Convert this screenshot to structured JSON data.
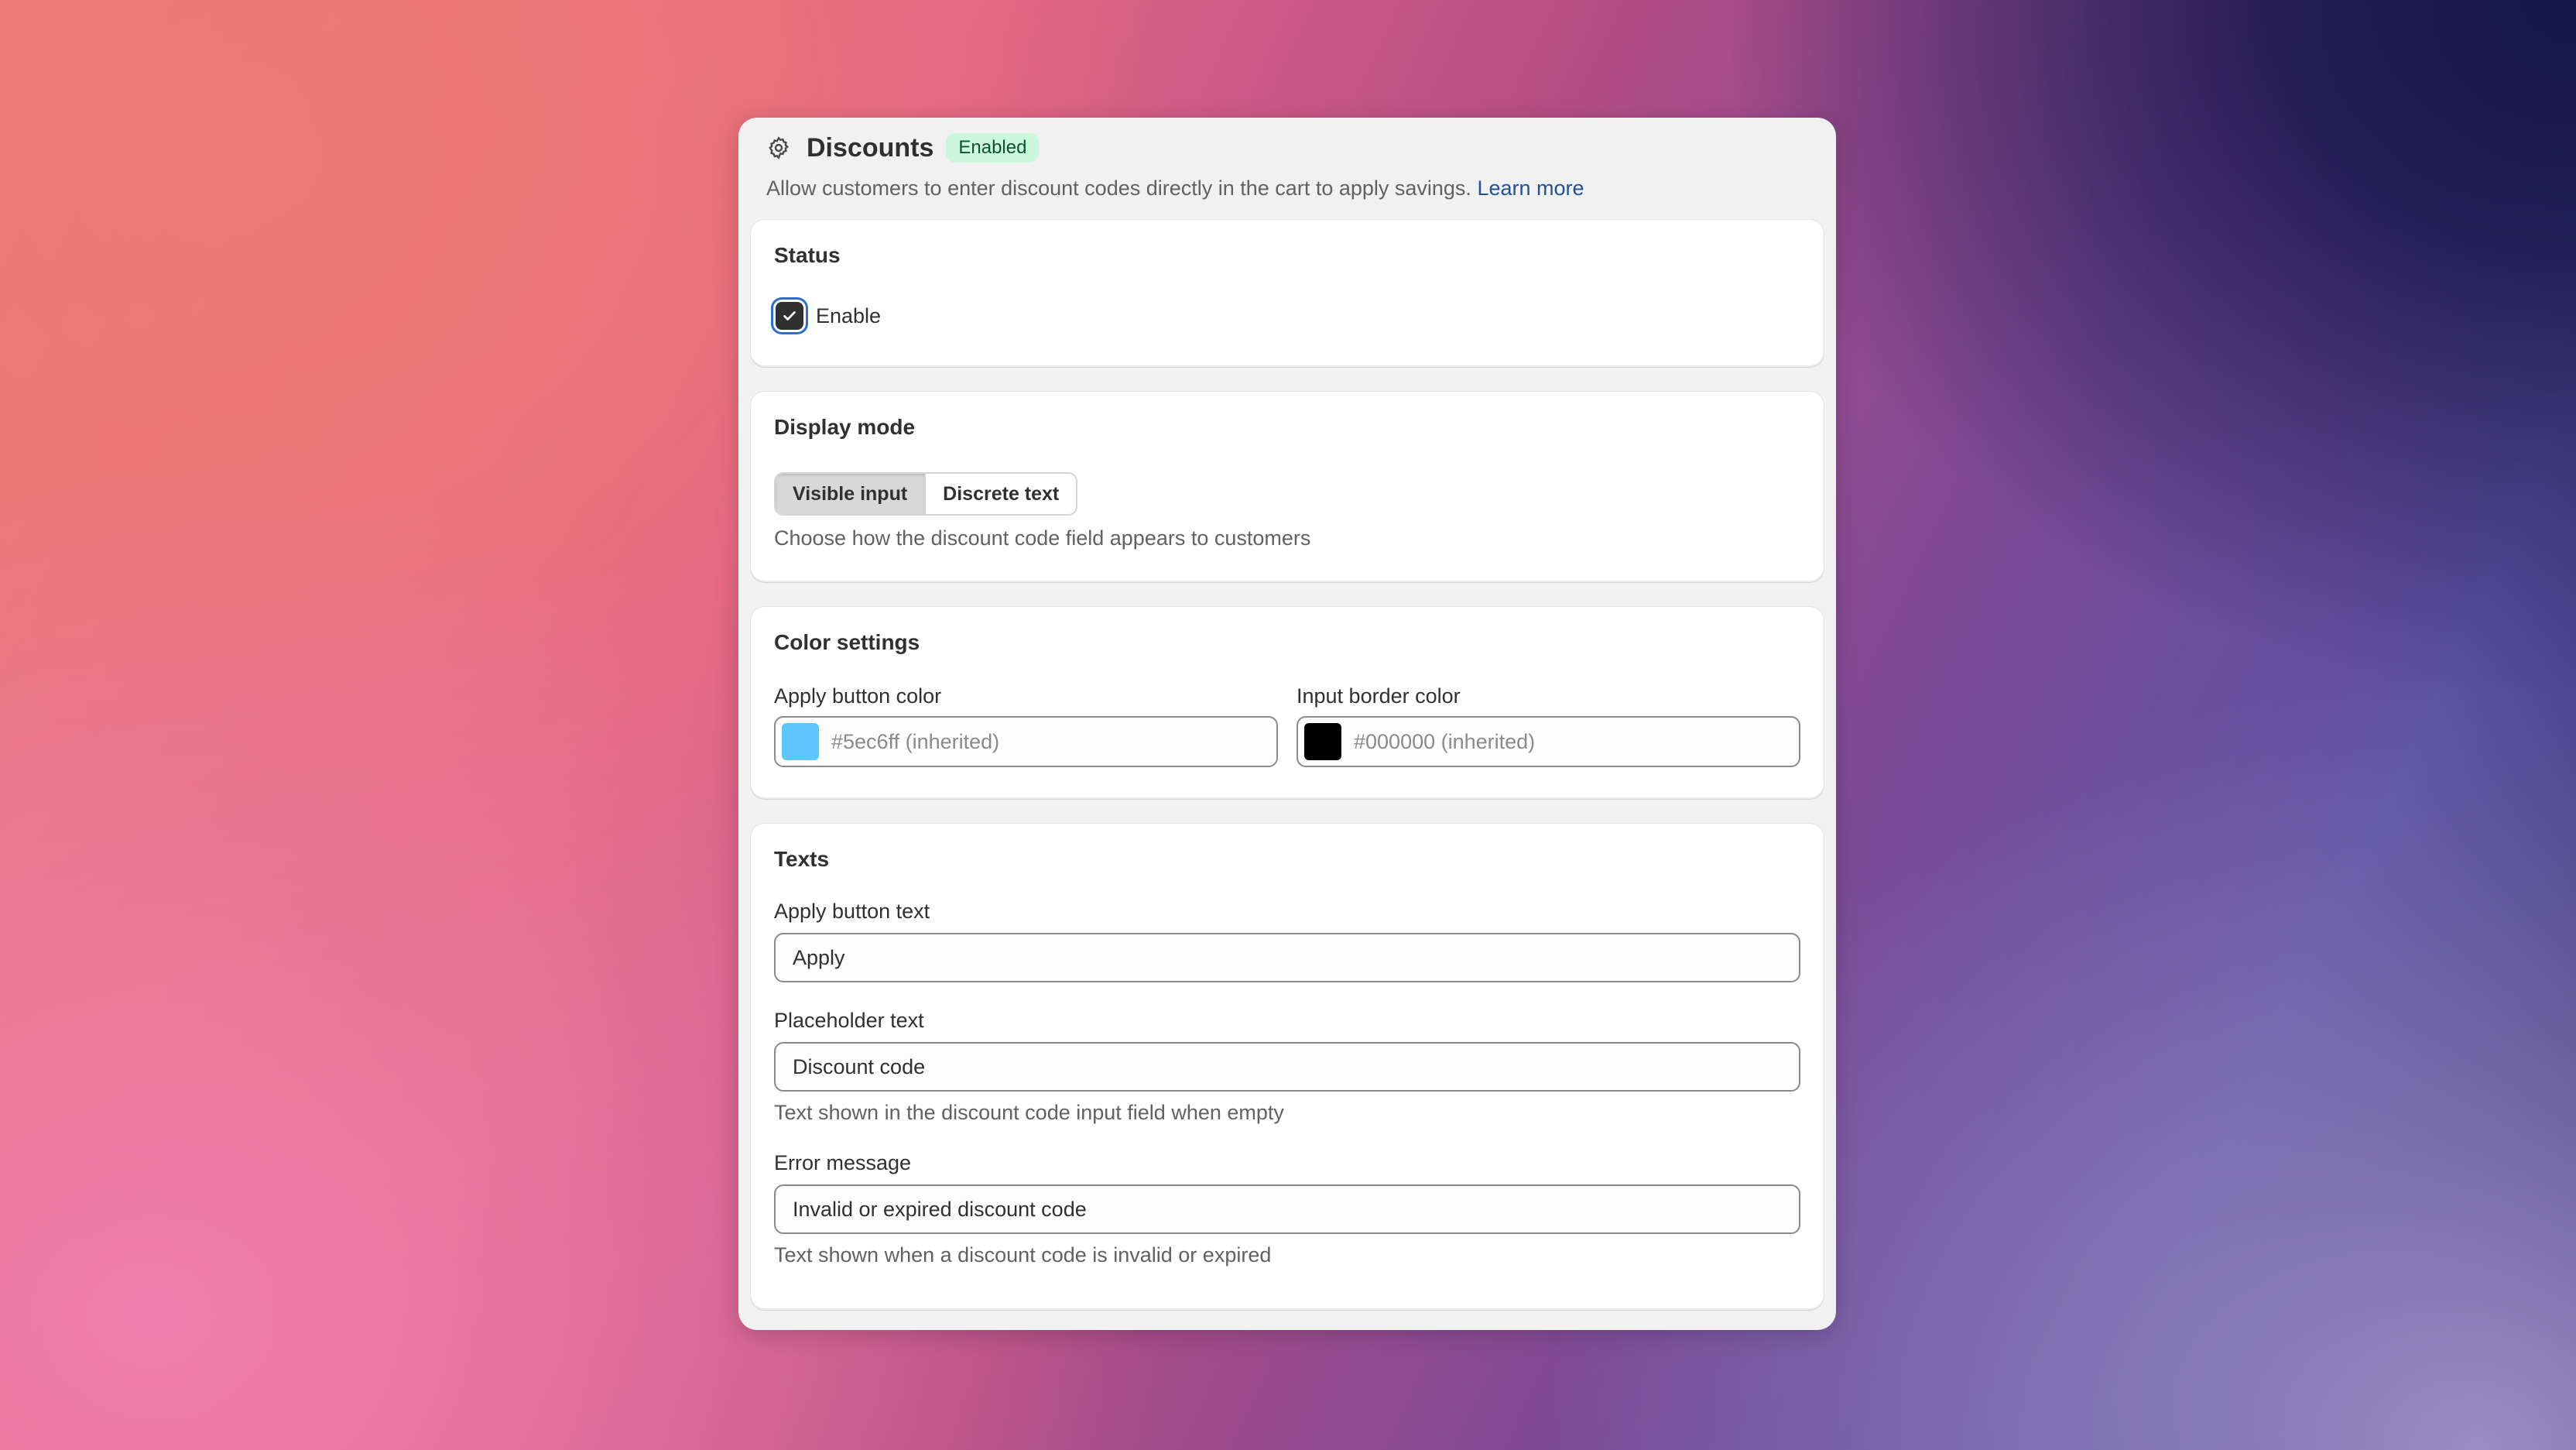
{
  "header": {
    "title": "Discounts",
    "badge": "Enabled",
    "description": "Allow customers to enter discount codes directly in the cart to apply savings.",
    "learn_more": "Learn more",
    "icon": "gear-icon"
  },
  "status": {
    "heading": "Status",
    "checkbox_label": "Enable",
    "checked": true
  },
  "display_mode": {
    "heading": "Display mode",
    "options": [
      "Visible input",
      "Discrete text"
    ],
    "selected": "Visible input",
    "help": "Choose how the discount code field appears to customers"
  },
  "color_settings": {
    "heading": "Color settings",
    "apply_button": {
      "label": "Apply button color",
      "value": "#5ec6ff (inherited)",
      "swatch": "#5ec6ff"
    },
    "input_border": {
      "label": "Input border color",
      "value": "#000000 (inherited)",
      "swatch": "#000000"
    }
  },
  "texts": {
    "heading": "Texts",
    "apply_text": {
      "label": "Apply button text",
      "value": "Apply"
    },
    "placeholder": {
      "label": "Placeholder text",
      "value": "Discount code",
      "help": "Text shown in the discount code input field when empty"
    },
    "error": {
      "label": "Error message",
      "value": "Invalid or expired discount code",
      "help": "Text shown when a discount code is invalid or expired"
    }
  }
}
